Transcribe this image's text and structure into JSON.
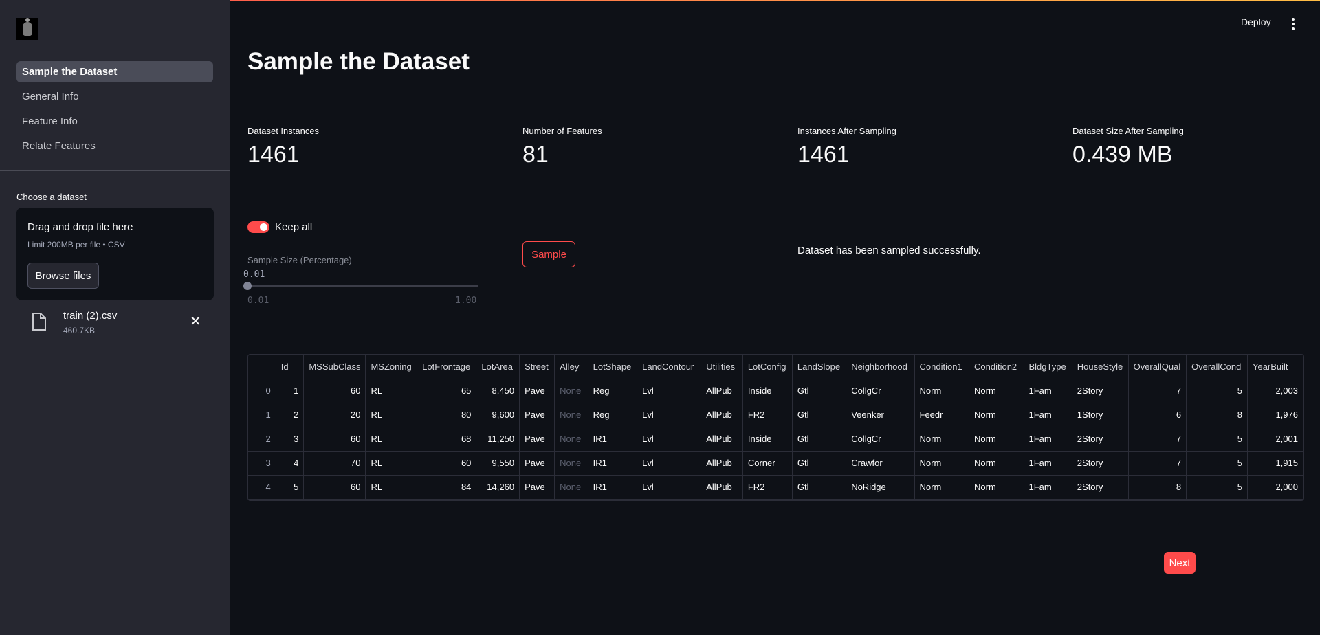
{
  "sidebar": {
    "nav": [
      {
        "label": "Sample the Dataset",
        "active": true
      },
      {
        "label": "General Info",
        "active": false
      },
      {
        "label": "Feature Info",
        "active": false
      },
      {
        "label": "Relate Features",
        "active": false
      }
    ],
    "choose_label": "Choose a dataset",
    "uploader": {
      "title": "Drag and drop file here",
      "limit": "Limit 200MB per file • CSV",
      "browse_label": "Browse files"
    },
    "file": {
      "name": "train (2).csv",
      "size": "460.7KB"
    }
  },
  "header": {
    "deploy_label": "Deploy"
  },
  "main": {
    "title": "Sample the Dataset",
    "metrics": [
      {
        "label": "Dataset Instances",
        "value": "1461"
      },
      {
        "label": "Number of Features",
        "value": "81"
      },
      {
        "label": "Instances After Sampling",
        "value": "1461"
      },
      {
        "label": "Dataset Size After Sampling",
        "value": "0.439 MB"
      }
    ],
    "keep_all": {
      "label": "Keep all",
      "on": true
    },
    "slider": {
      "label": "Sample Size (Percentage)",
      "value": "0.01",
      "min": "0.01",
      "max": "1.00"
    },
    "sample_label": "Sample",
    "success": "Dataset has been sampled successfully.",
    "next_label": "Next"
  },
  "table": {
    "columns": [
      "",
      "Id",
      "MSSubClass",
      "MSZoning",
      "LotFrontage",
      "LotArea",
      "Street",
      "Alley",
      "LotShape",
      "LandContour",
      "Utilities",
      "LotConfig",
      "LandSlope",
      "Neighborhood",
      "Condition1",
      "Condition2",
      "BldgType",
      "HouseStyle",
      "OverallQual",
      "OverallCond",
      "YearBuilt"
    ],
    "rows": [
      [
        "0",
        "1",
        "60",
        "RL",
        "65",
        "8,450",
        "Pave",
        "None",
        "Reg",
        "Lvl",
        "AllPub",
        "Inside",
        "Gtl",
        "CollgCr",
        "Norm",
        "Norm",
        "1Fam",
        "2Story",
        "7",
        "5",
        "2,003"
      ],
      [
        "1",
        "2",
        "20",
        "RL",
        "80",
        "9,600",
        "Pave",
        "None",
        "Reg",
        "Lvl",
        "AllPub",
        "FR2",
        "Gtl",
        "Veenker",
        "Feedr",
        "Norm",
        "1Fam",
        "1Story",
        "6",
        "8",
        "1,976"
      ],
      [
        "2",
        "3",
        "60",
        "RL",
        "68",
        "11,250",
        "Pave",
        "None",
        "IR1",
        "Lvl",
        "AllPub",
        "Inside",
        "Gtl",
        "CollgCr",
        "Norm",
        "Norm",
        "1Fam",
        "2Story",
        "7",
        "5",
        "2,001"
      ],
      [
        "3",
        "4",
        "70",
        "RL",
        "60",
        "9,550",
        "Pave",
        "None",
        "IR1",
        "Lvl",
        "AllPub",
        "Corner",
        "Gtl",
        "Crawfor",
        "Norm",
        "Norm",
        "1Fam",
        "2Story",
        "7",
        "5",
        "1,915"
      ],
      [
        "4",
        "5",
        "60",
        "RL",
        "84",
        "14,260",
        "Pave",
        "None",
        "IR1",
        "Lvl",
        "AllPub",
        "FR2",
        "Gtl",
        "NoRidge",
        "Norm",
        "Norm",
        "1Fam",
        "2Story",
        "8",
        "5",
        "2,000"
      ]
    ]
  }
}
